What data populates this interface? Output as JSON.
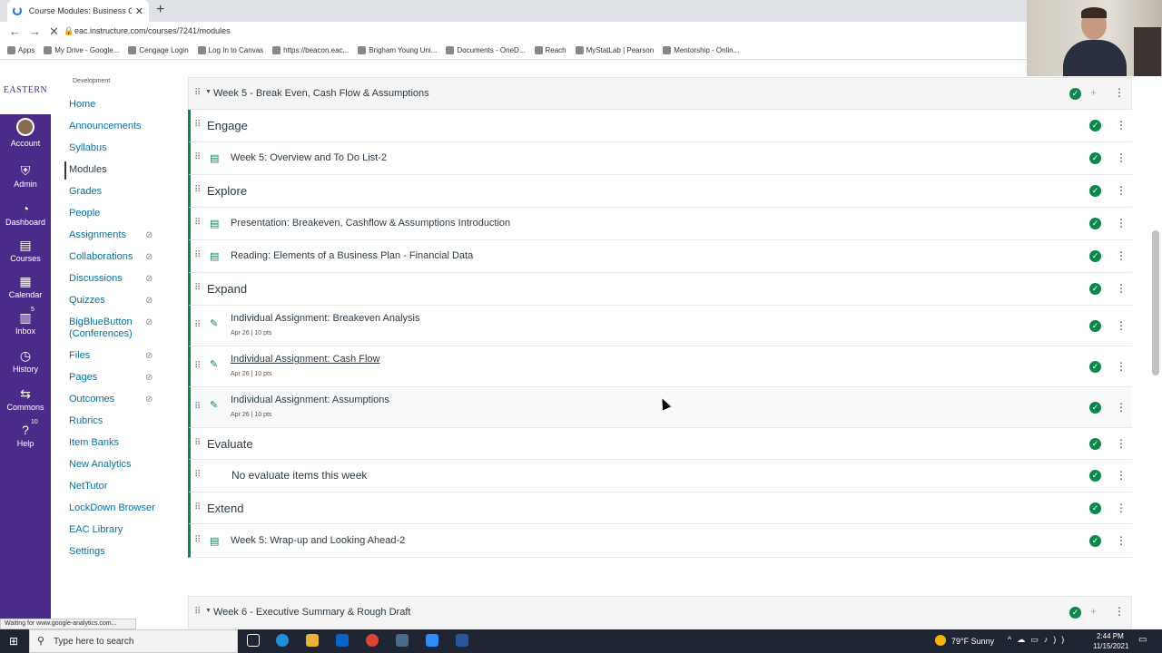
{
  "browser": {
    "tab_title": "Course Modules: Business Capst",
    "tab_close": "✕",
    "new_tab": "+",
    "url": "eac.instructure.com/courses/7241/modules",
    "bookmarks": [
      "Apps",
      "My Drive - Google...",
      "Cengage Login",
      "Log In to Canvas",
      "https://beacon.eac...",
      "Brigham Young Uni...",
      "Documents - OneD...",
      "Reach",
      "MyStatLab | Pearson",
      "Mentorship - Onlin..."
    ],
    "status_text": "Waiting for www.google-analytics.com..."
  },
  "logo_text": "EASTERN",
  "global_nav": [
    {
      "label": "Account",
      "icon": "user-avatar"
    },
    {
      "label": "Admin",
      "icon": "shield-icon"
    },
    {
      "label": "Dashboard",
      "icon": "dashboard-icon"
    },
    {
      "label": "Courses",
      "icon": "book-icon"
    },
    {
      "label": "Calendar",
      "icon": "calendar-icon"
    },
    {
      "label": "Inbox",
      "icon": "inbox-icon",
      "badge": "5"
    },
    {
      "label": "History",
      "icon": "clock-icon"
    },
    {
      "label": "Commons",
      "icon": "commons-icon"
    },
    {
      "label": "Help",
      "icon": "help-icon",
      "badge": "10"
    }
  ],
  "course_nav": {
    "subaccount": "Development",
    "items": [
      {
        "label": "Home"
      },
      {
        "label": "Announcements"
      },
      {
        "label": "Syllabus"
      },
      {
        "label": "Modules",
        "active": true
      },
      {
        "label": "Grades"
      },
      {
        "label": "People"
      },
      {
        "label": "Assignments",
        "hidden": true
      },
      {
        "label": "Collaborations",
        "hidden": true
      },
      {
        "label": "Discussions",
        "hidden": true
      },
      {
        "label": "Quizzes",
        "hidden": true
      },
      {
        "label": "BigBlueButton (Conferences)",
        "hidden": true
      },
      {
        "label": "Files",
        "hidden": true
      },
      {
        "label": "Pages",
        "hidden": true
      },
      {
        "label": "Outcomes",
        "hidden": true
      },
      {
        "label": "Rubrics"
      },
      {
        "label": "Item Banks"
      },
      {
        "label": "New Analytics"
      },
      {
        "label": "NetTutor"
      },
      {
        "label": "LockDown Browser"
      },
      {
        "label": "EAC Library"
      },
      {
        "label": "Settings"
      }
    ]
  },
  "modules": [
    {
      "title": "Week 5 - Break Even, Cash Flow & Assumptions",
      "items": [
        {
          "type": "header",
          "name": "Engage"
        },
        {
          "type": "page",
          "name": "Week 5: Overview and To Do List-2"
        },
        {
          "type": "header",
          "name": "Explore"
        },
        {
          "type": "page",
          "name": "Presentation: Breakeven, Cashflow & Assumptions Introduction"
        },
        {
          "type": "page",
          "name": "Reading: Elements of a Business Plan - Financial Data"
        },
        {
          "type": "header",
          "name": "Expand"
        },
        {
          "type": "assignment",
          "name": "Individual Assignment: Breakeven Analysis",
          "date": "Apr 26",
          "pts": "10 pts"
        },
        {
          "type": "assignment",
          "name": "Individual Assignment: Cash Flow",
          "date": "Apr 26",
          "pts": "10 pts"
        },
        {
          "type": "assignment",
          "name": "Individual Assignment: Assumptions",
          "date": "Apr 26",
          "pts": "10 pts"
        },
        {
          "type": "header",
          "name": "Evaluate"
        },
        {
          "type": "text",
          "name": "No evaluate items this week"
        },
        {
          "type": "header",
          "name": "Extend"
        },
        {
          "type": "page",
          "name": "Week 5: Wrap-up and Looking Ahead-2"
        }
      ]
    },
    {
      "title": "Week 6 - Executive Summary & Rough Draft"
    }
  ],
  "taskbar": {
    "search_placeholder": "Type here to search",
    "weather": "79°F  Sunny",
    "time": "2:44 PM",
    "date": "11/15/2021"
  },
  "colors": {
    "nav_bg": "#4a2b8a",
    "link": "#0770a3",
    "published": "#0b874b"
  }
}
